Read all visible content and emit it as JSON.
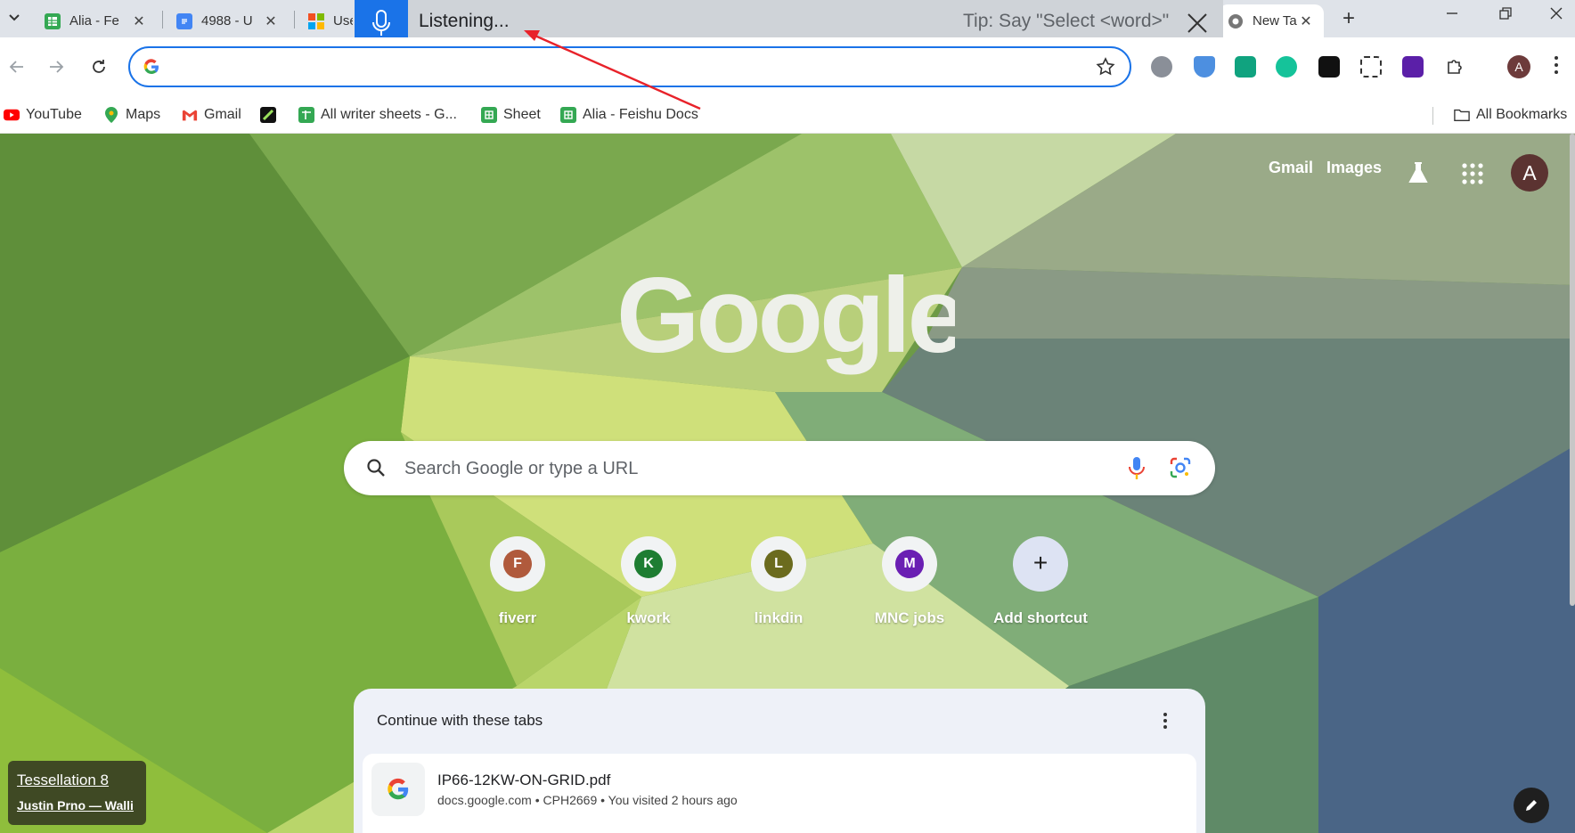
{
  "tabs": [
    {
      "title": "Alia - Fe",
      "favicon": "sheets-icon",
      "color": "#34a853"
    },
    {
      "title": "4988 - U",
      "favicon": "docs-icon",
      "color": "#4285f4"
    },
    {
      "title": "Use",
      "favicon": "microsoft-icon",
      "color": "#f25022"
    },
    {
      "title": "New Ta",
      "favicon": "chrome-icon",
      "active": true
    }
  ],
  "voice_overlay": {
    "status": "Listening...",
    "tip": "Tip: Say \"Select <word>\""
  },
  "toolbar": {
    "omnibox_value": "",
    "profile_letter": "A"
  },
  "bookmarks": [
    {
      "label": "YouTube",
      "icon": "youtube-icon",
      "color": "#ff0000"
    },
    {
      "label": "Maps",
      "icon": "maps-icon",
      "color": "#34a853"
    },
    {
      "label": "Gmail",
      "icon": "gmail-icon",
      "color": "#ea4335"
    },
    {
      "label": "",
      "icon": "app-icon",
      "color": "#111111"
    },
    {
      "label": "All writer sheets - G...",
      "icon": "sheets-icon",
      "color": "#34a853"
    },
    {
      "label": "Sheet",
      "icon": "sheets-icon",
      "color": "#34a853"
    },
    {
      "label": "Alia - Feishu Docs",
      "icon": "sheets-icon",
      "color": "#34a853"
    }
  ],
  "all_bookmarks_label": "All Bookmarks",
  "ntp": {
    "header_links": [
      "Gmail",
      "Images"
    ],
    "avatar_letter": "A",
    "search_placeholder": "Search Google or type a URL",
    "shortcuts": [
      {
        "name": "fiverr",
        "letter": "F",
        "color": "#b05a3c"
      },
      {
        "name": "kwork",
        "letter": "K",
        "color": "#1e7d32"
      },
      {
        "name": "linkdin",
        "letter": "L",
        "color": "#6b6b1e"
      },
      {
        "name": "MNC jobs",
        "letter": "M",
        "color": "#6a1fb3"
      },
      {
        "name": "Add shortcut",
        "letter": "+",
        "color": "#1f1f1f"
      }
    ],
    "continue_title": "Continue with these tabs",
    "continue_items": [
      {
        "name": "IP66-12KW-ON-GRID.pdf",
        "meta": "docs.google.com • CPH2669 • You visited 2 hours ago"
      }
    ],
    "attribution": {
      "title": "Tessellation 8",
      "author": "Justin Prno — Walli"
    }
  },
  "colors": {
    "accent": "#1a73e8",
    "tabstrip": "#dfe3e9"
  }
}
